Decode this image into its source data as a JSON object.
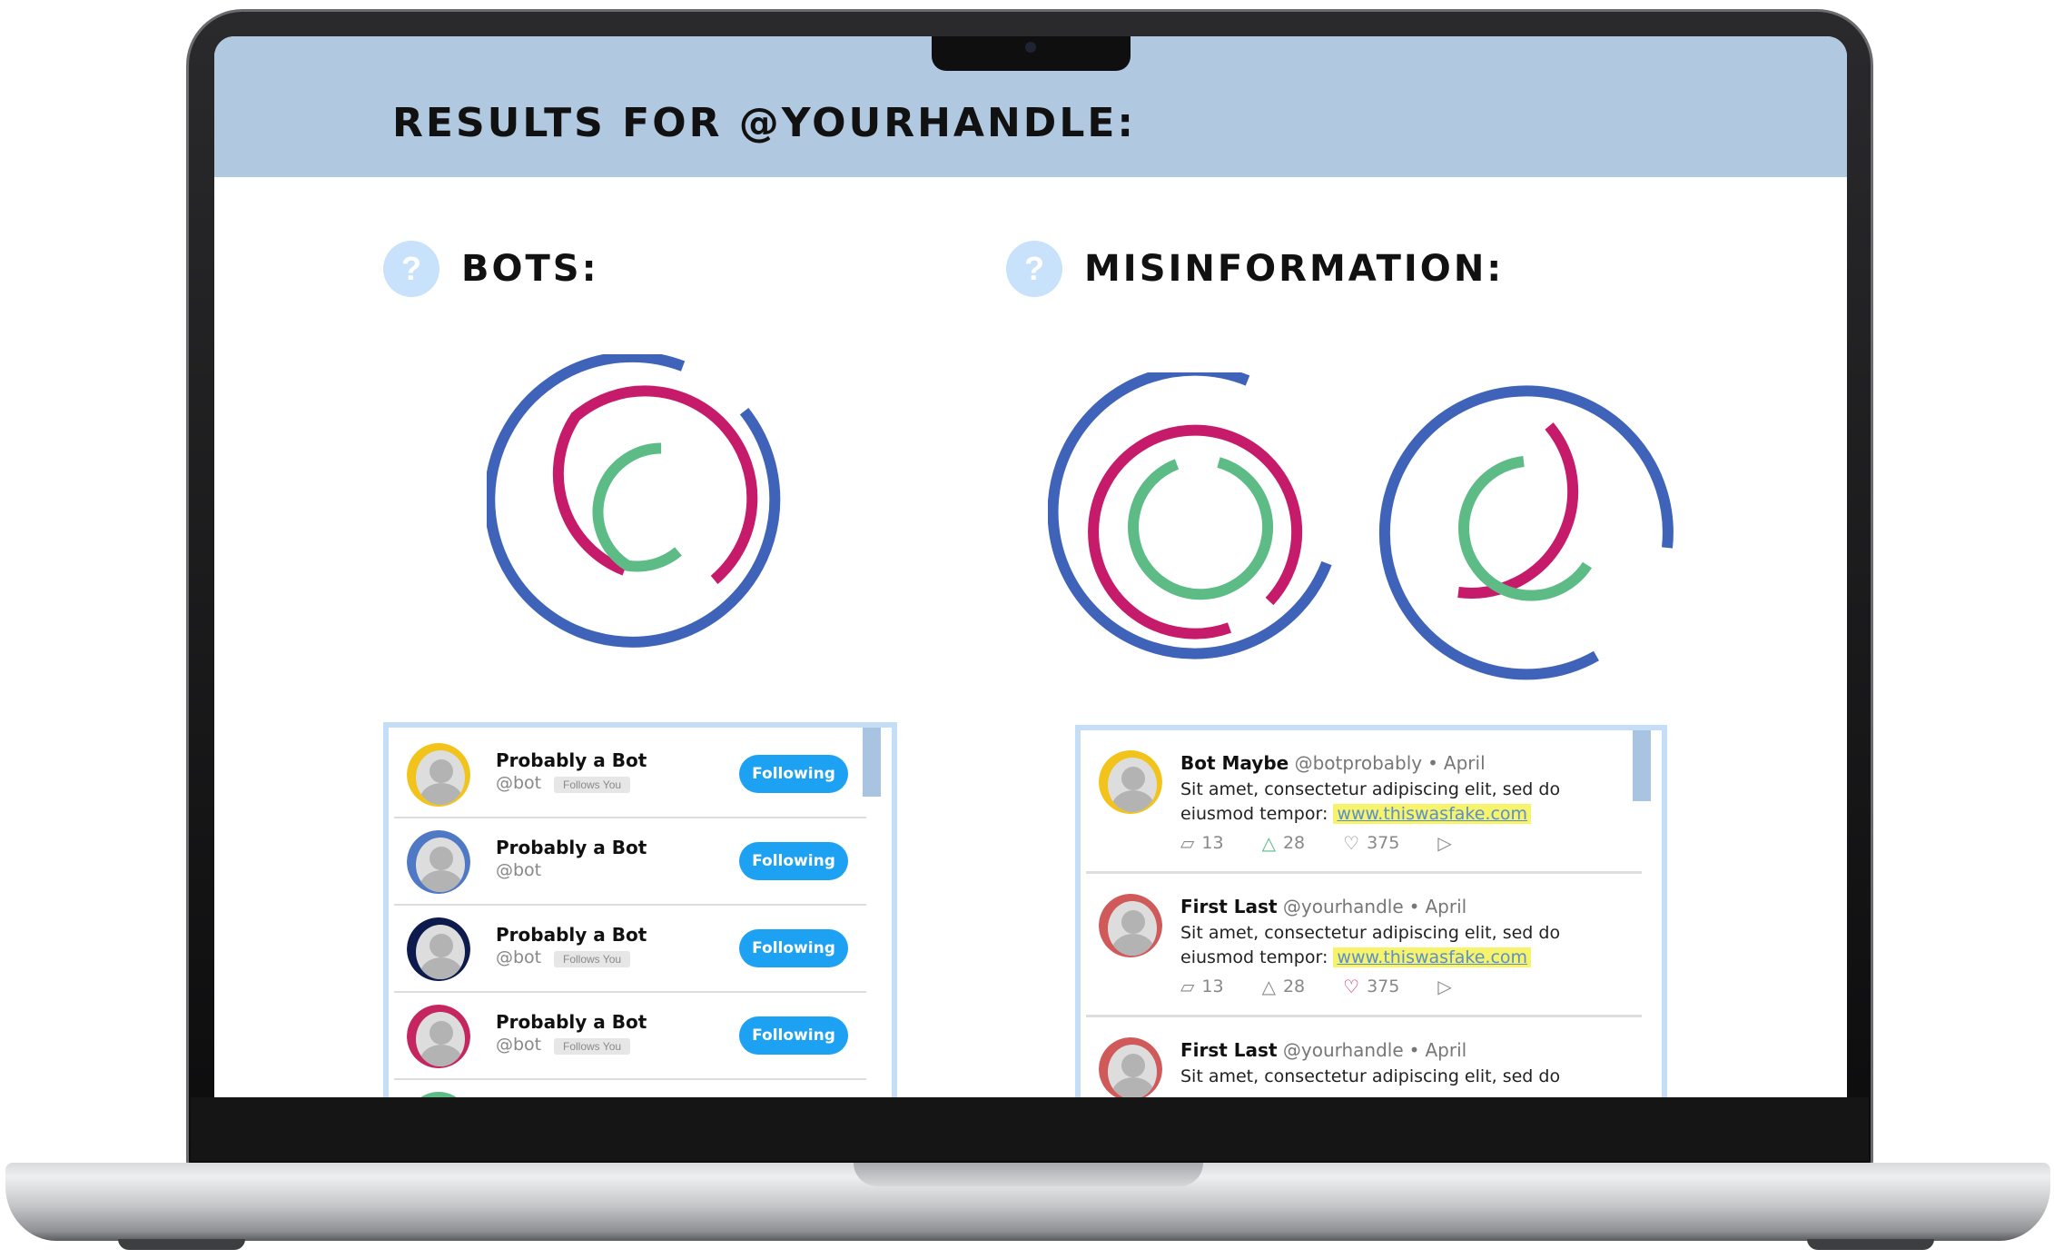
{
  "header": {
    "title": "RESULTS FOR @YOURHANDLE:"
  },
  "sections": {
    "bots": {
      "title": "BOTS:",
      "help": "?"
    },
    "misinformation": {
      "title": "MISINFORMATION:",
      "help": "?"
    }
  },
  "colors": {
    "header_bg": "#b0c8e0",
    "ring_blue": "#3f63b8",
    "ring_magenta": "#c61a6b",
    "ring_green": "#5dbb85",
    "following_button": "#1da1f2",
    "link_highlight": "#f7f36a",
    "panel_border": "#c4def7"
  },
  "bot_list": {
    "following_label": "Following",
    "follows_you_label": "Follows You",
    "items": [
      {
        "name": "Probably a Bot",
        "handle": "@bot",
        "follows_you": true,
        "avatar_ring": "#f2c31b",
        "avatar_icon": "person-avatar-icon"
      },
      {
        "name": "Probably a Bot",
        "handle": "@bot",
        "follows_you": false,
        "avatar_ring": "#4f79c4",
        "avatar_icon": "person-avatar-icon"
      },
      {
        "name": "Probably a Bot",
        "handle": "@bot",
        "follows_you": true,
        "avatar_ring": "#0c1a4d",
        "avatar_icon": "person-avatar-icon"
      },
      {
        "name": "Probably a Bot",
        "handle": "@bot",
        "follows_you": true,
        "avatar_ring": "#c6265f",
        "avatar_icon": "person-avatar-icon"
      }
    ]
  },
  "tweets": [
    {
      "name": "Bot Maybe",
      "handle": "@botprobably",
      "date": "April",
      "text1": "Sit amet, consectetur adipiscing elit, sed do",
      "text2": "eiusmod tempor:",
      "link": "www.thiswasfake.com",
      "comments": "13",
      "retweets": "28",
      "likes": "375",
      "avatar_ring": "#f2c31b",
      "liked": false
    },
    {
      "name": "First Last",
      "handle": "@yourhandle",
      "date": "April",
      "text1": "Sit amet, consectetur adipiscing elit, sed do",
      "text2": "eiusmod tempor:",
      "link": "www.thiswasfake.com",
      "comments": "13",
      "retweets": "28",
      "likes": "375",
      "avatar_ring": "#d05a5a",
      "liked": true
    },
    {
      "name": "First Last",
      "handle": "@yourhandle",
      "date": "April",
      "text1": "Sit amet, consectetur adipiscing elit, sed do",
      "text2": "",
      "link": "",
      "comments": "",
      "retweets": "",
      "likes": "",
      "avatar_ring": "#d05a5a",
      "liked": false
    }
  ]
}
